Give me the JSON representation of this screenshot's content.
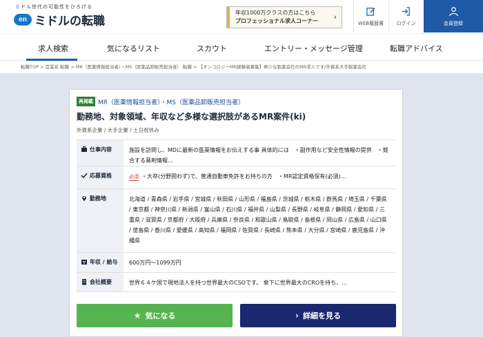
{
  "header": {
    "tagline": "ミドル世代の可能性をひろげる",
    "logo_badge": "en",
    "logo_text": "ミドルの転職",
    "promo_line1": "年収1000万クラスの方はこちら",
    "promo_line2": "プロフェッショナル求人コーナー",
    "promo_arrow": "›",
    "buttons": [
      {
        "label": "WEB履歴書",
        "icon": "edit-icon"
      },
      {
        "label": "ログイン",
        "icon": "login-icon"
      },
      {
        "label": "会員登録",
        "icon": "user-icon"
      }
    ]
  },
  "nav": {
    "items": [
      "求人検索",
      "気になるリスト",
      "スカウト",
      "エントリー・メッセージ管理",
      "転職アドバイス"
    ]
  },
  "breadcrumb": "転職TOP > 営業系 転職 > MR（医薬情報担当者）・MS（医薬品卸販売担当者） 転職 > 【オンコロジーMR経験者募集】希少な製薬会社のMR求人です/外資系大手製薬会社",
  "job": {
    "badge": "再掲載",
    "type": "MR（医薬情報担当者）・MS（医薬品卸販売担当者）",
    "title": "勤務地、対象領域、年収など多様な選択肢があるMR案件(ki)",
    "company_tags": "外資系企業 / 大手企業 / 土日祝休み",
    "details": [
      {
        "label": "仕事内容",
        "icon": "briefcase-icon",
        "text": "施設を訪問し、MDに最新の医薬情報をお伝えする事 具体的には　・副作用など安全性情報の提供　・競合する薬剤情報…"
      },
      {
        "label": "応募資格",
        "icon": "check-icon",
        "required": "必須",
        "text": "・大卒(分野問わず)で、普通自動車免許をお持ちの方　・MR認定資格保有(必須)…"
      },
      {
        "label": "勤務地",
        "icon": "pin-icon",
        "text": "北海道 / 青森県 / 岩手県 / 宮城県 / 秋田県 / 山形県 / 福島県 / 茨城県 / 栃木県 / 群馬県 / 埼玉県 / 千葉県 / 東京都 / 神奈川県 / 新潟県 / 富山県 / 石川県 / 福井県 / 山梨県 / 長野県 / 岐阜県 / 静岡県 / 愛知県 / 三重県 / 滋賀県 / 京都府 / 大阪府 / 兵庫県 / 奈良県 / 和歌山県 / 鳥取県 / 島根県 / 岡山県 / 広島県 / 山口県 / 徳島県 / 香川県 / 愛媛県 / 高知県 / 福岡県 / 佐賀県 / 長崎県 / 熊本県 / 大分県 / 宮崎県 / 鹿児島県 / 沖縄県"
      },
      {
        "label": "年収 / 給与",
        "icon": "yen-icon",
        "text": "600万円〜1099万円"
      },
      {
        "label": "会社概要",
        "icon": "building-icon",
        "text": "世界６４ケ国で現地法人を持つ世界最大のCSOです。 傘下に世界最大のCROを持ち、…"
      }
    ],
    "fav_label": "気になる",
    "fav_icon": "★",
    "detail_label": "詳細を見る",
    "detail_icon": "›"
  },
  "colors": {
    "brand_blue": "#1e5aa6",
    "fav_green": "#56b451",
    "detail_navy": "#1a2870",
    "badge_green": "#2f7e3d"
  }
}
